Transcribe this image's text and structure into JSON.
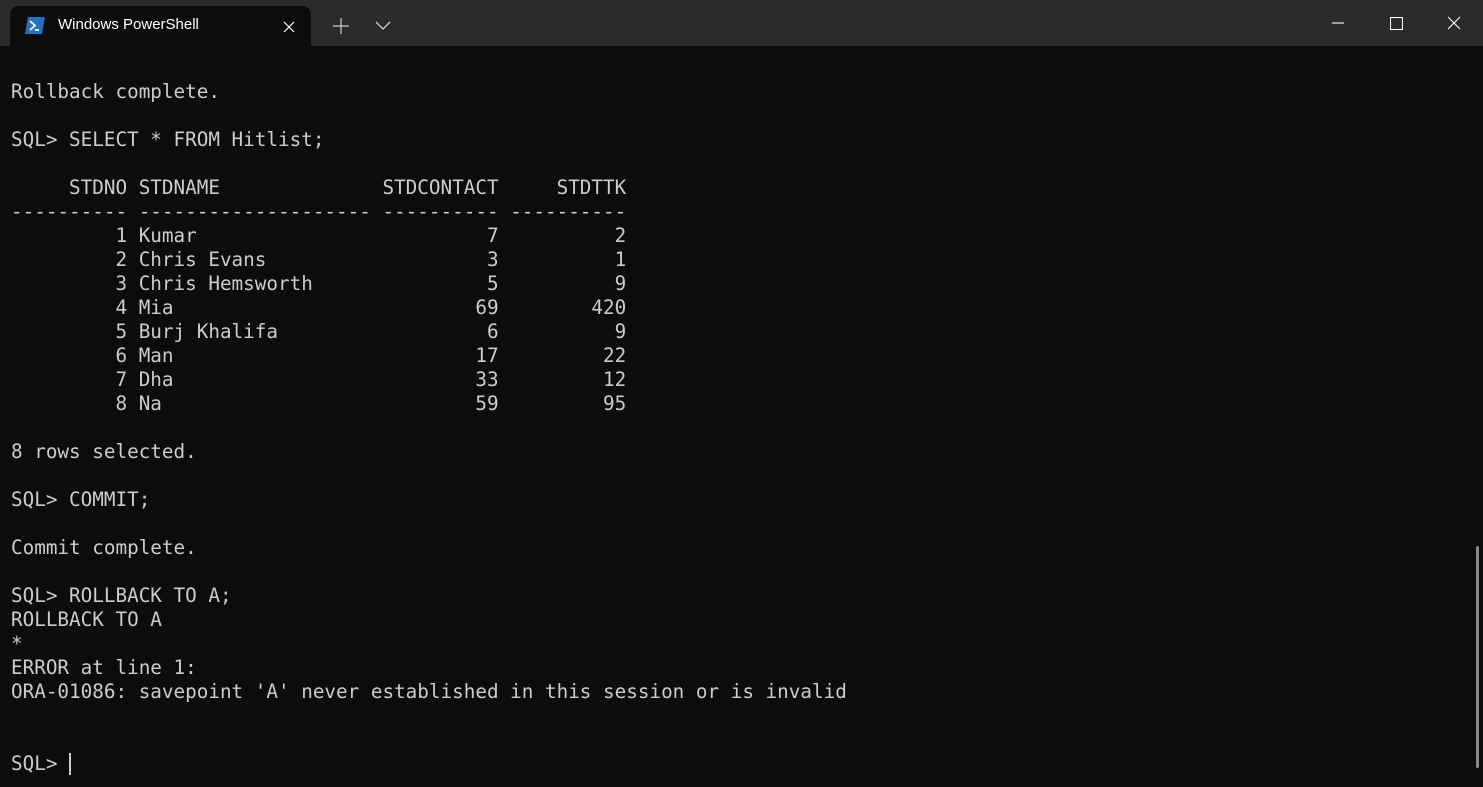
{
  "tab": {
    "title": "Windows PowerShell",
    "icon": "powershell-icon",
    "close_icon": "close-icon"
  },
  "titlebar": {
    "new_tab_icon": "plus-icon",
    "dropdown_icon": "chevron-down-icon",
    "minimize_icon": "minimize-icon",
    "maximize_icon": "maximize-icon",
    "close_icon": "close-icon"
  },
  "terminal": {
    "lines": [
      "Rollback complete.",
      "",
      "SQL> SELECT * FROM Hitlist;",
      "",
      "     STDNO STDNAME              STDCONTACT     STDTTK",
      "---------- -------------------- ---------- ----------",
      "         1 Kumar                         7          2",
      "         2 Chris Evans                   3          1",
      "         3 Chris Hemsworth               5          9",
      "         4 Mia                          69        420",
      "         5 Burj Khalifa                  6          9",
      "         6 Man                          17         22",
      "         7 Dha                          33         12",
      "         8 Na                           59         95",
      "",
      "8 rows selected.",
      "",
      "SQL> COMMIT;",
      "",
      "Commit complete.",
      "",
      "SQL> ROLLBACK TO A;",
      "ROLLBACK TO A",
      "*",
      "ERROR at line 1:",
      "ORA-01086: savepoint 'A' never established in this session or is invalid",
      "",
      ""
    ],
    "prompt": "SQL> "
  },
  "colors": {
    "background": "#0c0c0c",
    "titlebar": "#2b2b2b",
    "text": "#cccccc",
    "accent": "#2671be"
  }
}
